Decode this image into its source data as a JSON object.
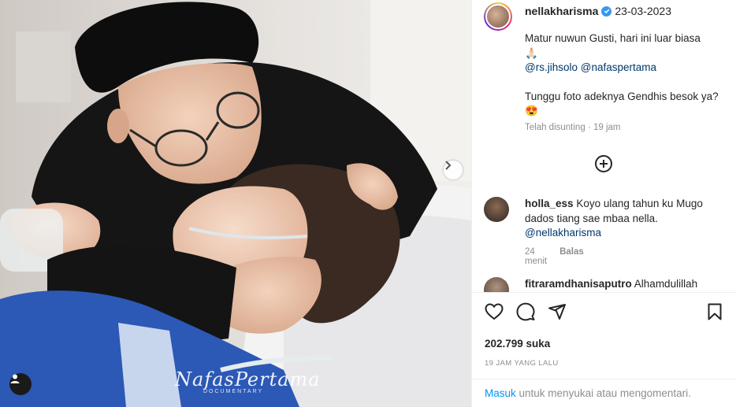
{
  "post": {
    "username": "nellakharisma",
    "date": "23-03-2023",
    "caption_line1": "Matur nuwun Gusti, hari ini luar biasa",
    "caption_emoji1": "🙏🏻",
    "mention1": "@rs.jihsolo",
    "mention2": "@nafaspertama",
    "caption_line2": "Tunggu foto adeknya Gendhis besok ya? 😍",
    "edited_label": "Telah disunting",
    "edited_dot": "·",
    "edited_time": "19 jam"
  },
  "comments": [
    {
      "username": "holla_ess",
      "text": "Koyo ulang tahun ku Mugo dados tiang sae mbaa nella.",
      "mention": "@nellakharisma",
      "time": "24 menit",
      "reply": "Balas"
    },
    {
      "username": "fitraramdhanisaputro",
      "text": "Alhamdulillah"
    }
  ],
  "stats": {
    "likes": "202.799 suka",
    "time_ago": "19 JAM YANG LALU"
  },
  "login": {
    "link": "Masuk",
    "text": "untuk menyukai atau mengomentari."
  },
  "photo": {
    "watermark": "NafasPertama",
    "watermark_sub": "DOCUMENTARY"
  },
  "icons": [
    "verified-icon",
    "add-comment-icon",
    "heart-icon",
    "comment-icon",
    "share-icon",
    "bookmark-icon",
    "chevron-right-icon",
    "user-tag-icon"
  ],
  "colors": {
    "accent": "#0095f6",
    "mention": "#00376b",
    "muted": "#8e8e8e",
    "verified": "#3897f0"
  }
}
